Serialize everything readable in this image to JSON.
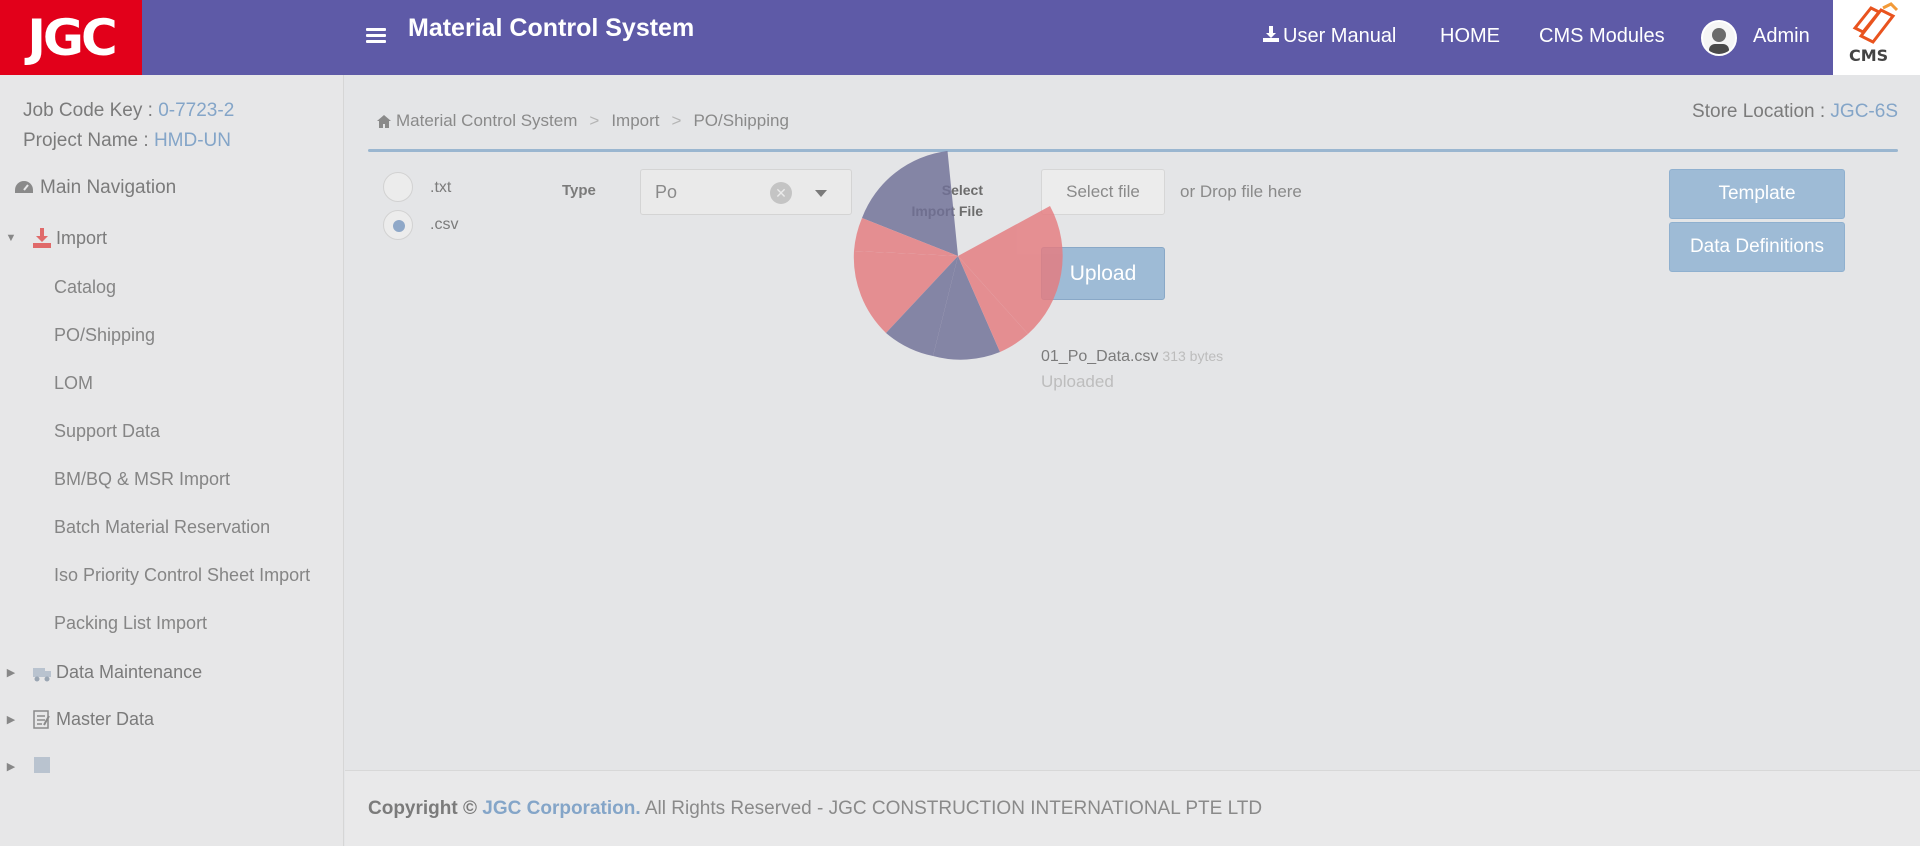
{
  "header": {
    "logo_text": "JGC",
    "app_title": "Material Control System",
    "nav": {
      "user_manual": "User Manual",
      "home": "HOME",
      "cms_modules": "CMS Modules",
      "admin": "Admin"
    },
    "cms_logo_text": "CMS",
    "brand_color": "#5e5aa7",
    "logo_red": "#e2001a"
  },
  "sidebar": {
    "job_code_label": "Job Code Key : ",
    "job_code_value": "0-7723-2",
    "project_label": "Project Name : ",
    "project_value": "HMD-UN",
    "main_nav_label": "Main Navigation",
    "import_label": "Import",
    "import_items": [
      "Catalog",
      "PO/Shipping",
      "LOM",
      "Support Data",
      "BM/BQ & MSR Import",
      "Batch Material Reservation",
      "Iso Priority Control Sheet Import",
      "Packing List Import"
    ],
    "data_maintenance_label": "Data Maintenance",
    "master_data_label": "Master Data"
  },
  "breadcrumb": {
    "home": "Material Control System",
    "level1": "Import",
    "level2": "PO/Shipping",
    "separator": ">"
  },
  "store": {
    "label": "Store Location : ",
    "value": "JGC-6S"
  },
  "form": {
    "radio_txt": ".txt",
    "radio_csv": ".csv",
    "selected_format": ".csv",
    "type_label": "Type",
    "type_value": "Po",
    "select_import_line1": "Select",
    "select_import_line2": "Import File",
    "select_file_button": "Select file",
    "drop_text": "or Drop file here",
    "upload_button": "Upload",
    "uploaded_file": {
      "name": "01_Po_Data.csv",
      "size": "313 bytes",
      "status": "Uploaded"
    }
  },
  "actions": {
    "template": "Template",
    "data_definitions": "Data Definitions"
  },
  "footer": {
    "copyright": "Copyright © ",
    "corp": "JGC Corporation.",
    "rest": " All Rights Reserved - JGC CONSTRUCTION INTERNATIONAL PTE LTD"
  },
  "loading_spinner": {
    "colors": [
      "#707097",
      "#e57b7f"
    ]
  }
}
